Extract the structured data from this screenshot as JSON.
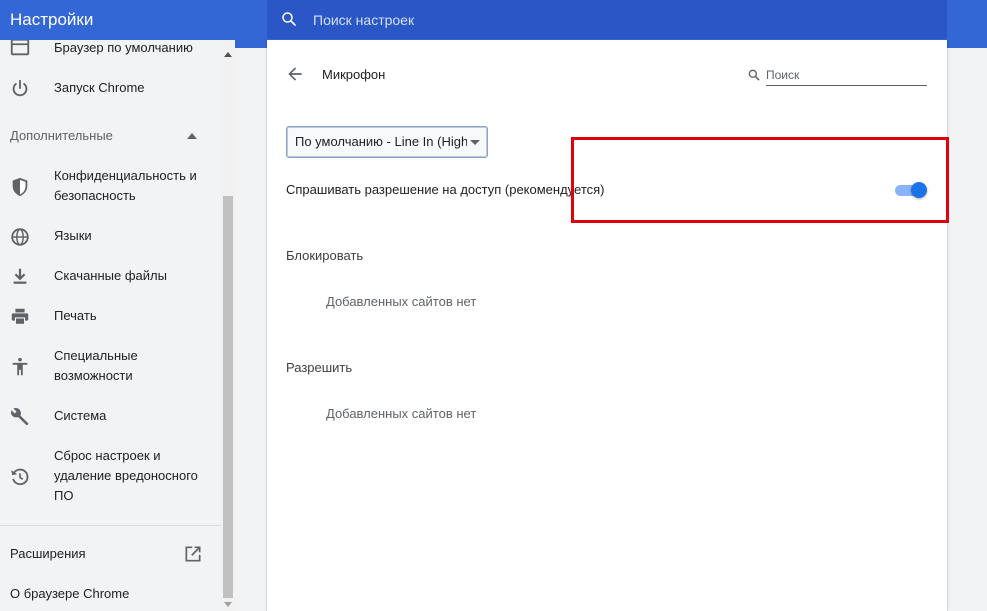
{
  "header": {
    "title": "Настройки",
    "search_placeholder": "Поиск настроек"
  },
  "sidebar": {
    "items": [
      {
        "label": "Браузер по умолчанию",
        "icon": "browser-window-icon"
      },
      {
        "label": "Запуск Chrome",
        "icon": "power-icon"
      },
      {
        "label": "Конфиденциальность и безопасность",
        "icon": "shield-icon"
      },
      {
        "label": "Языки",
        "icon": "globe-icon"
      },
      {
        "label": "Скачанные файлы",
        "icon": "download-icon"
      },
      {
        "label": "Печать",
        "icon": "printer-icon"
      },
      {
        "label": "Специальные возможности",
        "icon": "accessibility-icon"
      },
      {
        "label": "Система",
        "icon": "wrench-icon"
      },
      {
        "label": "Сброс настроек и удаление вредоносного ПО",
        "icon": "restore-icon"
      }
    ],
    "advanced_label": "Дополнительные",
    "extensions_label": "Расширения",
    "about_label": "О браузере Chrome"
  },
  "main": {
    "page_title": "Микрофон",
    "search_placeholder": "Поиск",
    "device_select_value": "По умолчанию - Line In (High",
    "ask_permission_label": "Спрашивать разрешение на доступ (рекомендуется)",
    "ask_permission_enabled": true,
    "block_section": {
      "title": "Блокировать",
      "empty_text": "Добавленных сайтов нет"
    },
    "allow_section": {
      "title": "Разрешить",
      "empty_text": "Добавленных сайтов нет"
    }
  },
  "colors": {
    "header_bg": "#3367d6",
    "search_bg": "#2a56c6",
    "toggle_on": "#1a73e8",
    "highlight": "#e0000f"
  }
}
